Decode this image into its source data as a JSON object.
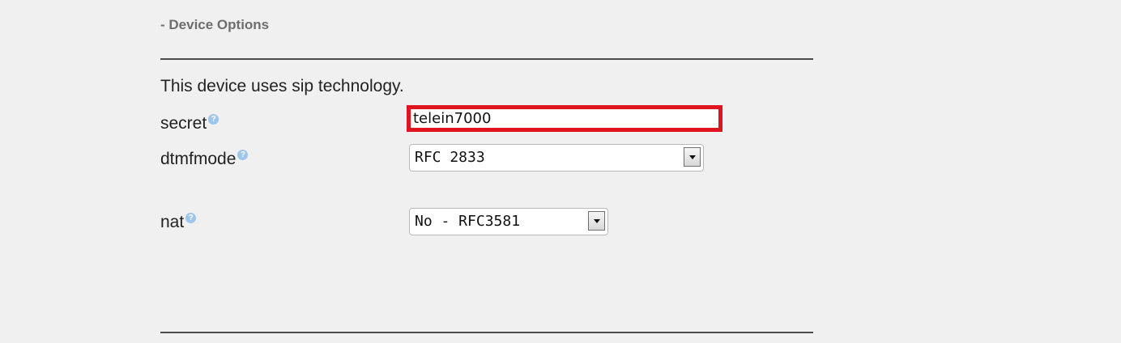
{
  "section": {
    "toggle_label": "- Device Options"
  },
  "tech_note": "This device uses sip technology.",
  "fields": {
    "secret": {
      "label": "secret",
      "value": "telein7000",
      "help_icon": "question-icon"
    },
    "dtmfmode": {
      "label": "dtmfmode",
      "selected": "RFC 2833",
      "help_icon": "question-icon"
    },
    "nat": {
      "label": "nat",
      "selected": "No - RFC3581",
      "help_icon": "question-icon"
    }
  },
  "help_glyph": "?",
  "colors": {
    "highlight_border": "#e0141e",
    "help_icon": "#9ec5ea",
    "background": "#f0f0f0"
  }
}
